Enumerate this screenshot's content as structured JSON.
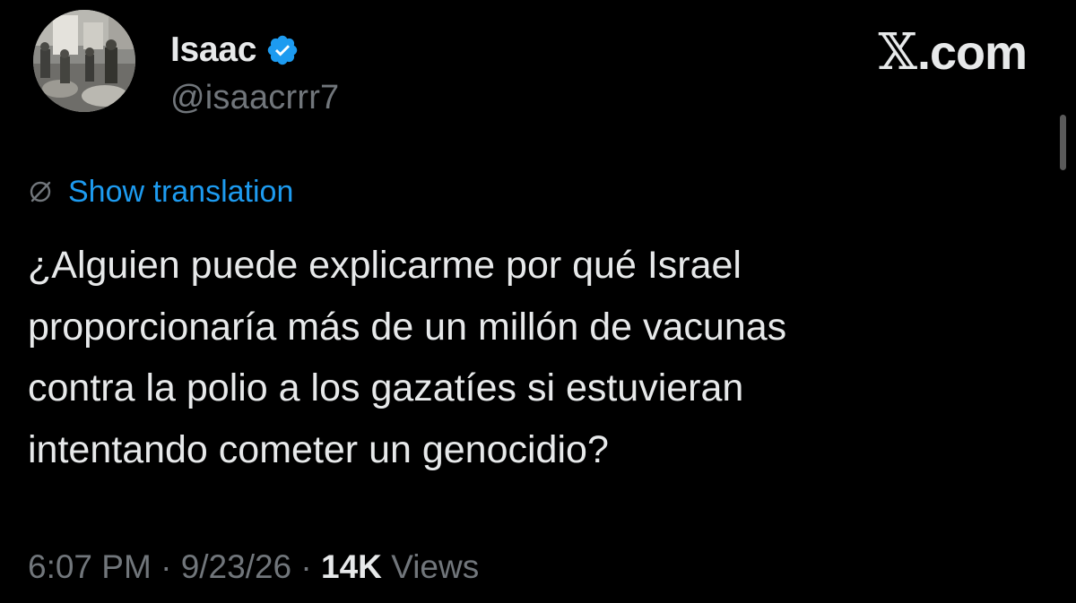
{
  "author": {
    "display_name": "Isaac",
    "handle": "@isaacrrr7",
    "verified": true
  },
  "brand": {
    "logo_mark": "𝕏",
    "logo_text": ".com"
  },
  "translation": {
    "icon": "translate-globe-icon",
    "label": "Show translation"
  },
  "tweet": {
    "lines": [
      "¿Alguien puede explicarme por qué Israel",
      "proporcionaría más de un millón de vacunas",
      "contra la polio a los gazatíes si estuvieran",
      "intentando cometer un genocidio?"
    ]
  },
  "meta": {
    "time": "6:07 PM",
    "separator": "·",
    "date": "9/23/26",
    "views_count": "14K",
    "views_label": "Views"
  },
  "colors": {
    "background": "#000000",
    "text": "#e7e9ea",
    "secondary": "#71767b",
    "link": "#1d9bf0",
    "verified": "#1d9bf0"
  }
}
